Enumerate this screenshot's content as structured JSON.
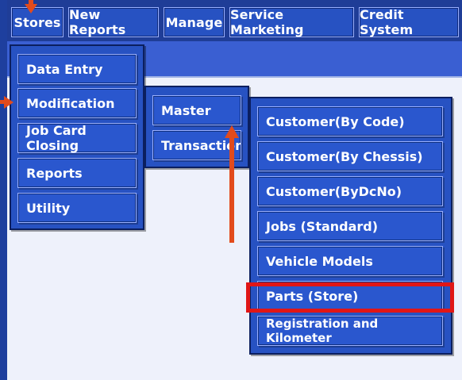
{
  "top_menu": {
    "items": [
      {
        "label": "Stores"
      },
      {
        "label": "New Reports"
      },
      {
        "label": "Manage"
      },
      {
        "label": "Service Marketing"
      },
      {
        "label": "Credit System"
      }
    ]
  },
  "stores_menu": {
    "items": [
      {
        "label": "Data Entry"
      },
      {
        "label": "Modification"
      },
      {
        "label": "Job Card Closing"
      },
      {
        "label": "Reports"
      },
      {
        "label": "Utility"
      }
    ]
  },
  "modification_menu": {
    "items": [
      {
        "label": "Master"
      },
      {
        "label": "Transaction"
      }
    ]
  },
  "master_menu": {
    "items": [
      {
        "label": "Customer(By Code)"
      },
      {
        "label": "Customer(By Chessis)"
      },
      {
        "label": "Customer(ByDcNo)"
      },
      {
        "label": "Jobs (Standard)"
      },
      {
        "label": "Vehicle Models"
      },
      {
        "label": "Parts (Store)"
      },
      {
        "label": "Registration and Kilometer"
      }
    ]
  },
  "annotations": {
    "arrow_color": "#e24b1c",
    "highlight_color": "#e01616"
  }
}
